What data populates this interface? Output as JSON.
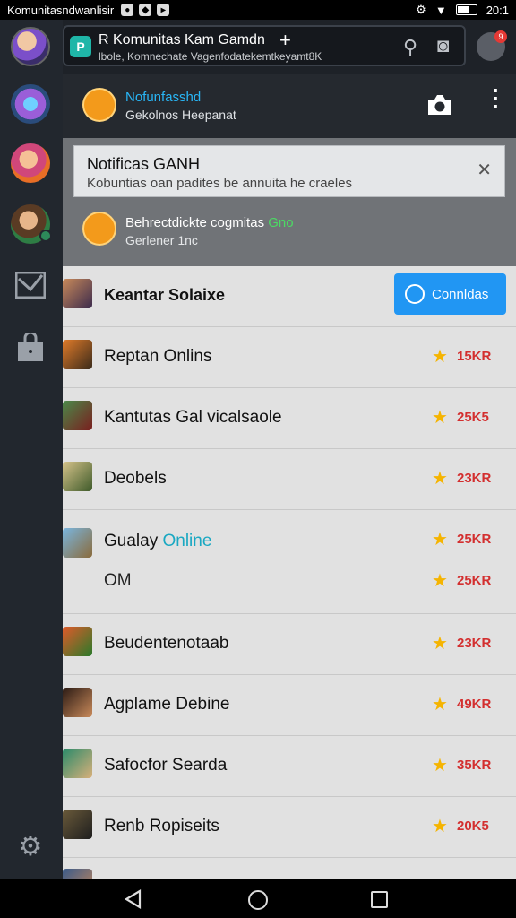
{
  "statusbar": {
    "title": "Komunitasndwanlisir",
    "time": "20:1"
  },
  "header": {
    "title": "R Komunitas Kam Gamdn",
    "subtitle": "lbole, Komnechate Vagenfodatekemtkeyamt8K",
    "hdr_badge": "9"
  },
  "notifications": {
    "first": {
      "title": "Nofunfasshd",
      "subtitle": "Gekolnos Heepanat"
    },
    "card": {
      "title": "Notificas GANH",
      "subtitle": "Kobuntias oan padites  be annuita he craeles",
      "close": "✕"
    },
    "second": {
      "title_main": "Behrectdickte cogmitas",
      "title_accent": "Gno",
      "subtitle": "Gerlener 1nc"
    }
  },
  "list": {
    "follow_button": "Connldas",
    "rows": [
      {
        "name": "Keantar Solaixe"
      },
      {
        "name": "Reptan Onlins",
        "value": "15KR"
      },
      {
        "name": "Kantutas Gal vicalsaole",
        "value": "25K5"
      },
      {
        "name": "Deobels",
        "value": "23KR"
      },
      {
        "name": "Gualay",
        "accent": "Online",
        "value": "25KR",
        "sub": "OM",
        "sub_value": "25KR"
      },
      {
        "name": "Beudentenotaab",
        "value": "23KR"
      },
      {
        "name": "Agplame Debine",
        "value": "49KR"
      },
      {
        "name": "Safocfor Searda",
        "value": "35KR"
      },
      {
        "name": "Renb Ropiseits",
        "value": "20K5"
      }
    ]
  },
  "colors": {
    "accent_blue": "#2196f3",
    "online_teal": "#1aa8c2",
    "value_red": "#d32f2f",
    "star_gold": "#f5b400"
  }
}
